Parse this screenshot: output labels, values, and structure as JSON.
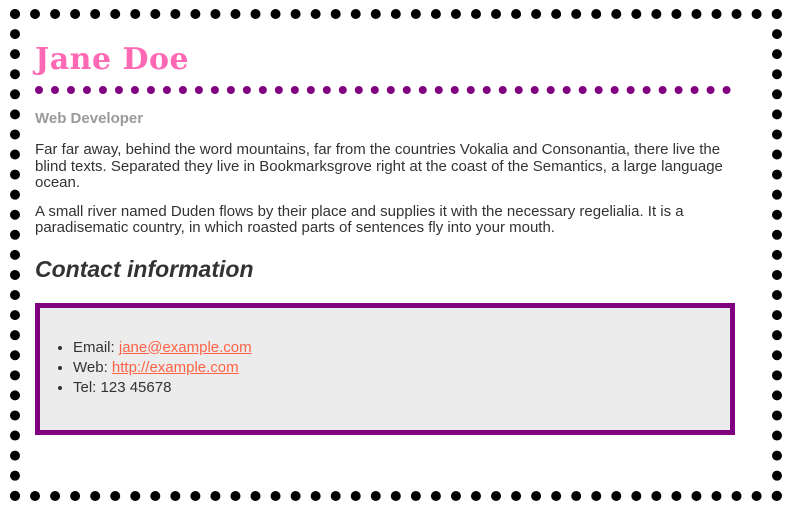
{
  "profile": {
    "name": "Jane Doe",
    "role": "Web Developer",
    "paragraphs": [
      "Far far away, behind the word mountains, far from the countries Vokalia and Consonantia, there live the blind texts. Separated they live in Bookmarksgrove right at the coast of the Semantics, a large language ocean.",
      "A small river named Duden flows by their place and supplies it with the necessary regelialia. It is a paradisematic country, in which roasted parts of sentences fly into your mouth."
    ]
  },
  "contact": {
    "heading": "Contact information",
    "email_label": "Email:",
    "email": "jane@example.com",
    "web_label": "Web:",
    "web": "http://example.com",
    "tel_label": "Tel:",
    "tel": "123 45678"
  },
  "colors": {
    "name": "#ff69b4",
    "accent": "#800080",
    "link": "#ff6347",
    "box_background": "#ececec"
  }
}
